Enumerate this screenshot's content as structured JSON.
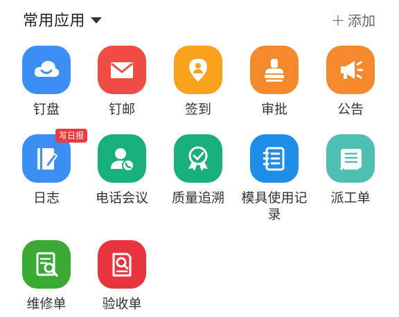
{
  "header": {
    "title": "常用应用",
    "add_label": "添加"
  },
  "apps": [
    {
      "label": "钉盘",
      "icon": "cloud-smile-icon",
      "color": "#3d8ff5"
    },
    {
      "label": "钉邮",
      "icon": "envelope-icon",
      "color": "#ef4d43"
    },
    {
      "label": "签到",
      "icon": "location-pin-icon",
      "color": "#f9a21a"
    },
    {
      "label": "审批",
      "icon": "stamp-icon",
      "color": "#f58a2c"
    },
    {
      "label": "公告",
      "icon": "megaphone-icon",
      "color": "#f58a2c"
    },
    {
      "label": "日志",
      "icon": "notebook-pencil-icon",
      "color": "#3d8ff5",
      "badge": "写日报"
    },
    {
      "label": "电话会议",
      "icon": "person-phone-icon",
      "color": "#19b17a"
    },
    {
      "label": "质量追溯",
      "icon": "quality-ribbon-icon",
      "color": "#19b17a"
    },
    {
      "label": "模具使用记录",
      "icon": "document-list-icon",
      "color": "#1e8fe8"
    },
    {
      "label": "派工单",
      "icon": "scroll-icon",
      "color": "#4fbfb3"
    },
    {
      "label": "维修单",
      "icon": "repair-form-icon",
      "color": "#3aaa35"
    },
    {
      "label": "验收单",
      "icon": "inspection-form-icon",
      "color": "#e8343f"
    }
  ]
}
